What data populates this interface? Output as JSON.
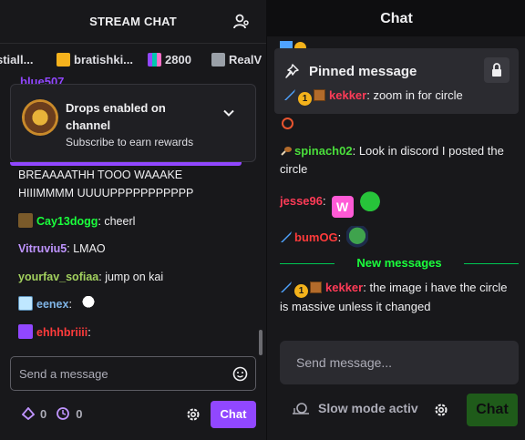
{
  "left_panel": {
    "title": "STREAM CHAT",
    "gift_bar": [
      {
        "name": "stiall...",
        "color": "#8ecbff"
      },
      {
        "name": "bratishki...",
        "color": "#ffb020"
      },
      {
        "name": "2800",
        "color": "#bf94ff"
      },
      {
        "name": "RealV",
        "color": "#adadb8"
      }
    ],
    "peek_user": "blue507",
    "drops": {
      "title": "Drops enabled on channel",
      "subtitle": "Subscribe to earn rewards"
    },
    "messages": [
      {
        "user": "",
        "text": "BREAAAATHH TOOO WAAAKE",
        "color": "#efeff1"
      },
      {
        "user": "",
        "text": "HIIIMMMM UUUUPPPPPPPPPPP",
        "color": "#efeff1"
      },
      {
        "user": "Cay13dogg",
        "text": "cheerl",
        "color": "#1aff3c"
      },
      {
        "user": "Vitruviu5",
        "text": "LMAO",
        "color": "#bf94ff"
      },
      {
        "user": "yourfav_sofiaa",
        "text": "jump on kai",
        "color": "#a2d05e"
      },
      {
        "user": "eenex",
        "text": "",
        "color": "#7fb4e6"
      },
      {
        "user": "ehhhbriiii",
        "text": "",
        "color": "#ff3b3b"
      }
    ],
    "input_placeholder": "Send a message",
    "points": {
      "bits": "0",
      "timer": "0"
    },
    "chat_button": "Chat"
  },
  "right_panel": {
    "title": "Chat",
    "pinned": {
      "title": "Pinned message",
      "user": "kekker",
      "user_color": "#ff3b57",
      "badge_number": "1",
      "text": "zoom in for circle"
    },
    "messages": [
      {
        "user": "spinach02",
        "text": "Look in discord I posted the circle",
        "color": "#4ade3b"
      },
      {
        "user": "jesse96",
        "text": "",
        "color": "#ff3b57"
      },
      {
        "user": "bumOG",
        "text": "",
        "color": "#ff3b3b"
      },
      {
        "user": "kekker",
        "text": "the image i have the circle is massive unless it changed",
        "color": "#ff3b57",
        "badge_number": "1"
      }
    ],
    "new_messages_label": "New messages",
    "input_placeholder": "Send message...",
    "slow_mode": "Slow mode activ",
    "chat_button": "Chat"
  }
}
